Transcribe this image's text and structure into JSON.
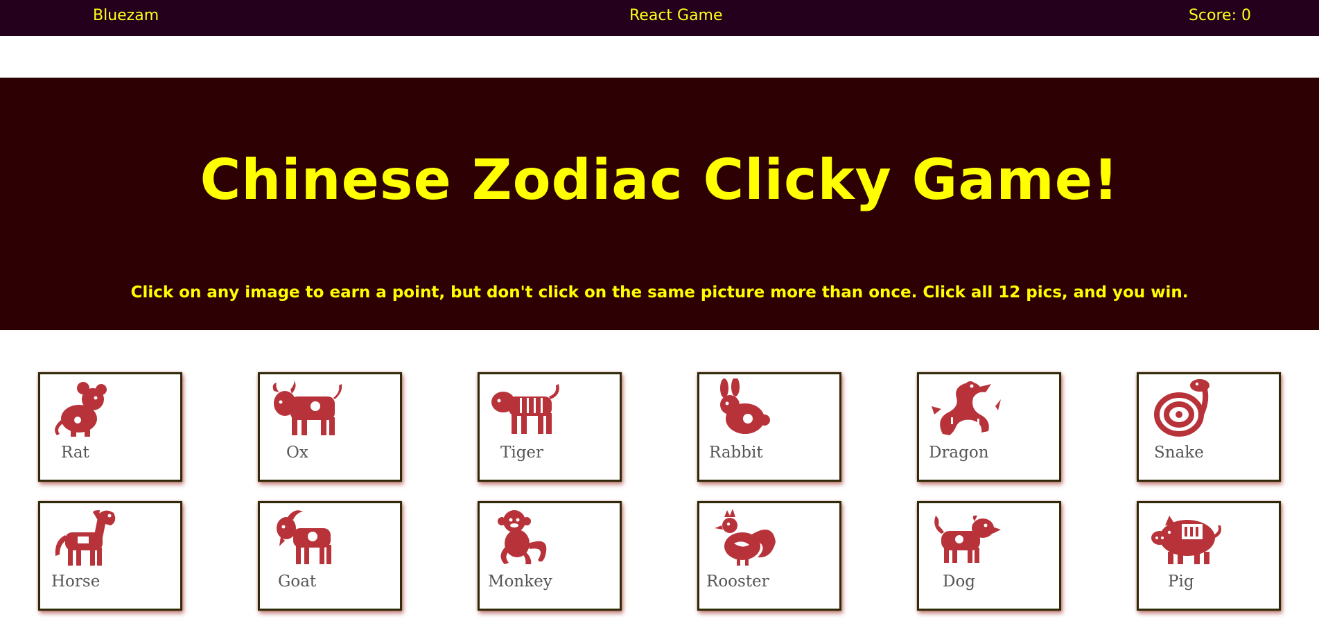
{
  "navbar": {
    "brand": "Bluezam",
    "title": "React Game",
    "score_text": "Score: 0"
  },
  "header": {
    "title": "Chinese Zodiac Clicky Game!",
    "instructions": "Click on any image to earn a point, but don't click on the same picture more than once. Click all 12 pics, and you win."
  },
  "colors": {
    "navbar_bg": "#24001d",
    "jumbotron_bg": "#2d0104",
    "accent_text": "#ffff00",
    "icon_red": "#b8323a",
    "card_border": "#2f2a08"
  },
  "cards": [
    {
      "label": "Rat",
      "icon": "rat-icon"
    },
    {
      "label": "Ox",
      "icon": "ox-icon"
    },
    {
      "label": "Tiger",
      "icon": "tiger-icon"
    },
    {
      "label": "Rabbit",
      "icon": "rabbit-icon"
    },
    {
      "label": "Dragon",
      "icon": "dragon-icon"
    },
    {
      "label": "Snake",
      "icon": "snake-icon"
    },
    {
      "label": "Horse",
      "icon": "horse-icon"
    },
    {
      "label": "Goat",
      "icon": "goat-icon"
    },
    {
      "label": "Monkey",
      "icon": "monkey-icon"
    },
    {
      "label": "Rooster",
      "icon": "rooster-icon"
    },
    {
      "label": "Dog",
      "icon": "dog-icon"
    },
    {
      "label": "Pig",
      "icon": "pig-icon"
    }
  ]
}
